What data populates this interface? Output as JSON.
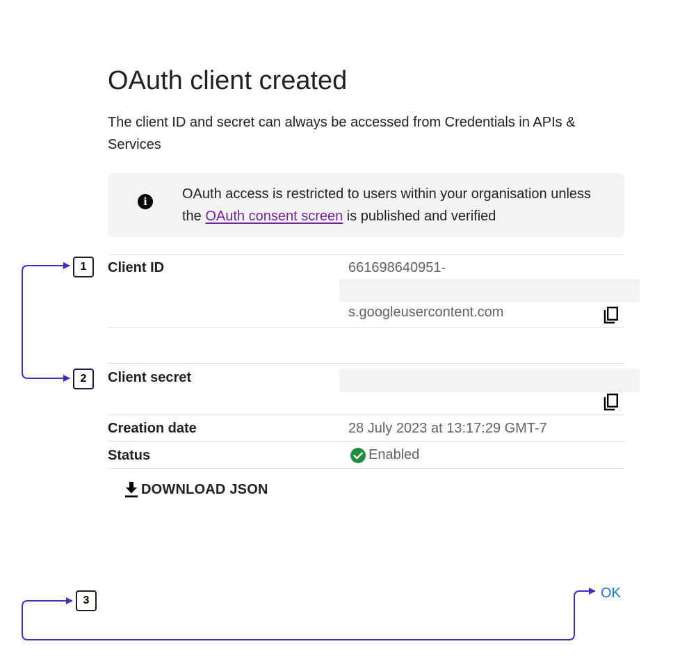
{
  "dialog": {
    "title": "OAuth client created",
    "description": "The client ID and secret can always be accessed from Credentials in APIs & Services"
  },
  "info_banner": {
    "icon": "info-icon",
    "text_before": "OAuth access is restricted to users within your organisation unless the ",
    "link_text": "OAuth consent screen",
    "text_after": " is published and verified"
  },
  "client_id": {
    "label": "Client ID",
    "value_prefix": "661698640951-",
    "value_suffix": "s.googleusercontent.com",
    "copy_icon": "copy-icon"
  },
  "client_secret": {
    "label": "Client secret",
    "copy_icon": "copy-icon"
  },
  "creation_date": {
    "label": "Creation date",
    "value": "28 July 2023 at 13:17:29 GMT-7"
  },
  "status": {
    "label": "Status",
    "value": "Enabled",
    "icon": "check-circle-icon",
    "color": "#1e8e3e"
  },
  "download": {
    "label": "DOWNLOAD JSON",
    "icon": "download-icon"
  },
  "ok_button": {
    "label": "OK",
    "color": "#1a73e8"
  },
  "annotations": {
    "badges": [
      "1",
      "2",
      "3"
    ],
    "arrow_color": "#3a2fbf"
  }
}
